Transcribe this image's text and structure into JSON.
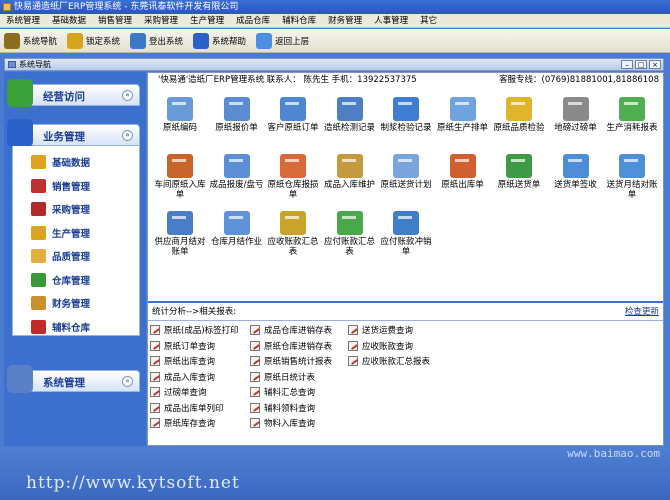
{
  "window": {
    "title": "快易通造纸厂ERP管理系统 - 东莞讯泰软件开发有限公司"
  },
  "menu": [
    "系统管理",
    "基础数据",
    "销售管理",
    "采购管理",
    "生产管理",
    "成品仓库",
    "辅料仓库",
    "财务管理",
    "人事管理",
    "其它"
  ],
  "toolbar": [
    {
      "label": "系统导航",
      "icon": "book-icon",
      "color": "#8a6d1e"
    },
    {
      "label": "锁定系统",
      "icon": "lock-icon",
      "color": "#d7a21c"
    },
    {
      "label": "登出系统",
      "icon": "users-icon",
      "color": "#3a78c8"
    },
    {
      "label": "系统帮助",
      "icon": "help-icon",
      "color": "#2a62c9"
    },
    {
      "label": "返回上层",
      "icon": "back-arrow-icon",
      "color": "#4b8fe0"
    }
  ],
  "panel": {
    "title": "系统导航",
    "buttons": [
      "–",
      "□",
      "×"
    ]
  },
  "sidebar": {
    "groups": [
      {
        "label": "经营访问",
        "toggle": "«"
      },
      {
        "label": "业务管理",
        "toggle": "»"
      },
      {
        "label": "系统管理",
        "toggle": "«"
      }
    ],
    "items": [
      {
        "label": "基础数据",
        "color": "#e0a020"
      },
      {
        "label": "销售管理",
        "color": "#c03030"
      },
      {
        "label": "采购管理",
        "color": "#b02a2a"
      },
      {
        "label": "生产管理",
        "color": "#d9a51a"
      },
      {
        "label": "品质管理",
        "color": "#e0b040"
      },
      {
        "label": "仓库管理",
        "color": "#3a9a3a"
      },
      {
        "label": "财务管理",
        "color": "#c89030"
      },
      {
        "label": "辅料仓库",
        "color": "#c02a2a"
      }
    ]
  },
  "info": {
    "company": "'快易通'造纸厂ERP管理系统    联系人：   陈先生  手机：13922537375",
    "hotline": "客服专线：(0769)81881001,81886108"
  },
  "modules": [
    {
      "label": "原纸编码",
      "color": "#6a9ad8"
    },
    {
      "label": "原纸报价单",
      "color": "#5b8bd0"
    },
    {
      "label": "客户原纸订单",
      "color": "#4f86d2"
    },
    {
      "label": "造纸检测记录",
      "color": "#4d7fc4"
    },
    {
      "label": "制浆检验记录",
      "color": "#3e7dd1"
    },
    {
      "label": "原纸生产排单",
      "color": "#6fa2e0"
    },
    {
      "label": "原纸品质检验",
      "color": "#e0b52c"
    },
    {
      "label": "地磅过磅单",
      "color": "#8a8a8a"
    },
    {
      "label": "生产消耗报表",
      "color": "#4fae4f"
    },
    {
      "label": "车间原纸入库单",
      "color": "#c9642a"
    },
    {
      "label": "成品报废/盘亏",
      "color": "#5d8fd6"
    },
    {
      "label": "原纸仓库报损单",
      "color": "#d86a3a"
    },
    {
      "label": "成品入库维护",
      "color": "#c59a3e"
    },
    {
      "label": "原纸送货计划",
      "color": "#7aa4dc"
    },
    {
      "label": "原纸出库单",
      "color": "#d06030"
    },
    {
      "label": "原纸送货单",
      "color": "#3f9a48"
    },
    {
      "label": "送货单签收",
      "color": "#4e8ed8"
    },
    {
      "label": "送货月结对账单",
      "color": "#5090d8"
    },
    {
      "label": "供应商月结对账单",
      "color": "#4a7dc8"
    },
    {
      "label": "仓库月结作业",
      "color": "#5f92d8"
    },
    {
      "label": "应收账款汇总表",
      "color": "#c8a42a"
    },
    {
      "label": "应付账款汇总表",
      "color": "#48a84a"
    },
    {
      "label": "应付账款冲销单",
      "color": "#3f7fca"
    }
  ],
  "reports": {
    "header": "统计分析-->相关报表:",
    "refresh": "检查更新",
    "columns": [
      [
        "原纸(成品)标签打印",
        "原纸订单查询",
        "原纸出库查询",
        "成品入库查询",
        "过磅单查询",
        "成品出库单列印",
        "原纸库存查询"
      ],
      [
        "成品仓库进销存表",
        "原纸仓库进销存表",
        "原纸销售统计报表",
        "原纸日统计表",
        "辅料汇总查询",
        "辅料领料查询",
        "物料入库查询"
      ],
      [
        "送货运费查询",
        "应收账款查询",
        "应收账款汇总报表"
      ]
    ]
  },
  "footer": {
    "url": "http://www.kytsoft.net",
    "site": "www.baimao.com"
  }
}
